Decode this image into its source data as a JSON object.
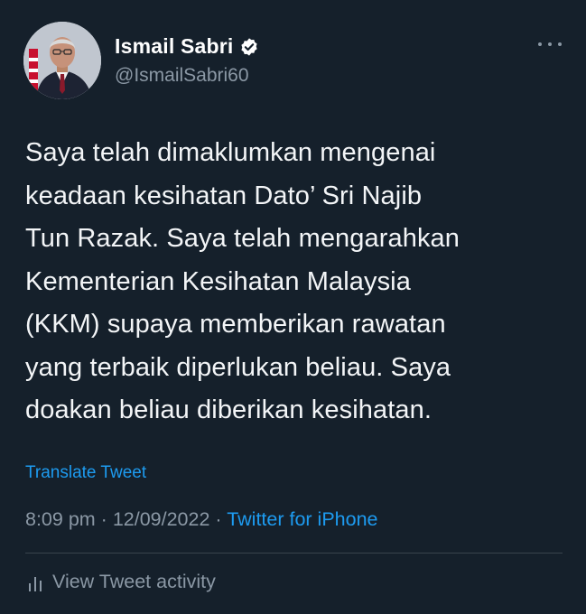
{
  "author": {
    "display_name": "Ismail Sabri",
    "handle": "@IsmailSabri60",
    "verified": true,
    "avatar_icon": "profile-photo"
  },
  "tweet": {
    "lines": [
      "Saya telah dimaklumkan mengenai",
      "keadaan kesihatan Dato’ Sri Najib",
      "Tun Razak. Saya telah mengarahkan",
      "Kementerian Kesihatan Malaysia",
      "(KKM) supaya memberikan rawatan",
      "yang terbaik diperlukan beliau. Saya",
      "doakan beliau diberikan kesihatan."
    ],
    "translate_label": "Translate Tweet"
  },
  "meta": {
    "time": "8:09 pm",
    "separator": "·",
    "date": "12/09/2022",
    "source": "Twitter for iPhone"
  },
  "actions": {
    "activity_label": "View Tweet activity",
    "activity_icon": "analytics-bars-icon",
    "more_icon": "more-options-icon"
  },
  "colors": {
    "background": "#15202b",
    "accent": "#1d9bf0",
    "secondary_text": "#8b98a5"
  }
}
